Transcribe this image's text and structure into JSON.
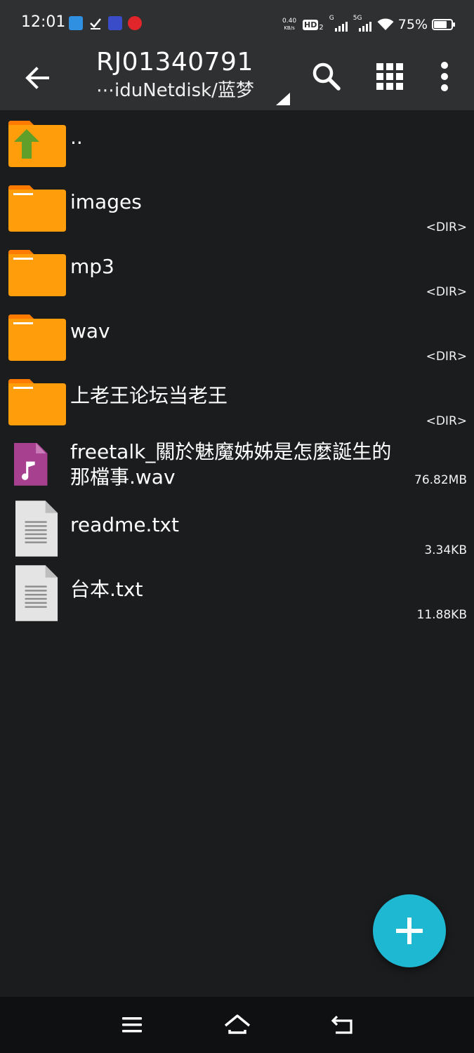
{
  "status_bar": {
    "time": "12:01",
    "net_speed_value": "0.40",
    "net_speed_unit": "KB/s",
    "hd_label": "HD",
    "hd_sub": "2",
    "sig1_label": "G",
    "sig2_label": "5G",
    "battery_pct": "75%",
    "battery_level": 0.75
  },
  "appbar": {
    "title": "RJ01340791",
    "path": "⋯iduNetdisk/蓝梦"
  },
  "files": [
    {
      "name": "..",
      "meta": "",
      "type": "parent"
    },
    {
      "name": "images",
      "meta": "<DIR>",
      "type": "folder"
    },
    {
      "name": "mp3",
      "meta": "<DIR>",
      "type": "folder"
    },
    {
      "name": "wav",
      "meta": "<DIR>",
      "type": "folder"
    },
    {
      "name": "上老王论坛当老王",
      "meta": "<DIR>",
      "type": "folder"
    },
    {
      "name_line1": "freetalk_關於魅魔姊姊是怎麼誕生的",
      "name_line2": "那檔事.wav",
      "meta": "76.82MB",
      "type": "audio"
    },
    {
      "name": "readme.txt",
      "meta": "3.34KB",
      "type": "text"
    },
    {
      "name": "台本.txt",
      "meta": "11.88KB",
      "type": "text"
    }
  ],
  "colors": {
    "folder": "#ff9d0a",
    "folder_tab": "#ff7a00",
    "up_arrow": "#5f9f2a",
    "audio_icon": "#a6408f",
    "fab": "#1fb8d2"
  }
}
